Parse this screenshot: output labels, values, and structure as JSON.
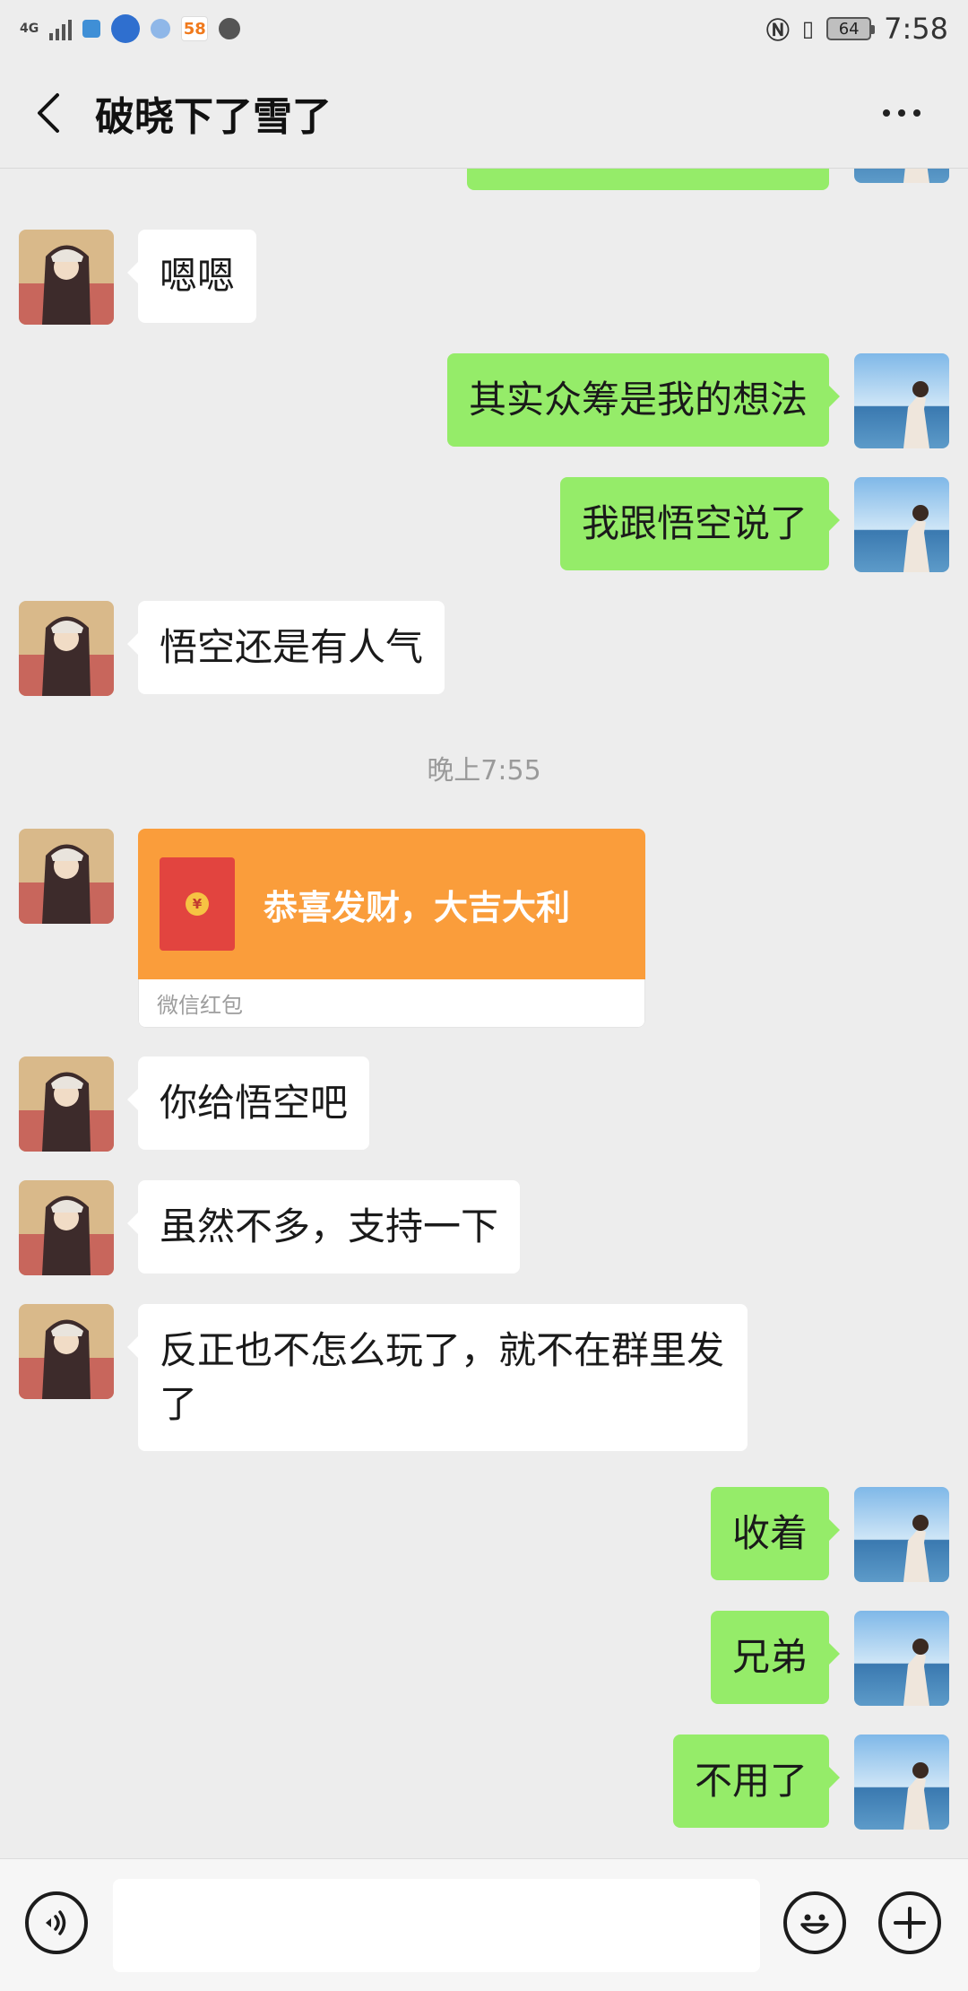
{
  "status_bar": {
    "network": "4G",
    "battery": "64",
    "time": "7:58",
    "app_icon_58": "58"
  },
  "header": {
    "title": "破晓下了雪了",
    "back_icon": "chevron-left-icon",
    "more_icon": "more-dots-icon"
  },
  "messages": [
    {
      "type": "text",
      "side": "in",
      "text": "嗯嗯"
    },
    {
      "type": "text",
      "side": "out",
      "text": "其实众筹是我的想法"
    },
    {
      "type": "text",
      "side": "out",
      "text": "我跟悟空说了"
    },
    {
      "type": "text",
      "side": "in",
      "text": "悟空还是有人气"
    },
    {
      "type": "time",
      "text": "晚上7:55"
    },
    {
      "type": "red_packet",
      "side": "in",
      "title": "恭喜发财，大吉大利",
      "footer": "微信红包"
    },
    {
      "type": "text",
      "side": "in",
      "text": "你给悟空吧"
    },
    {
      "type": "text",
      "side": "in",
      "text": "虽然不多，支持一下"
    },
    {
      "type": "text",
      "side": "in",
      "text": "反正也不怎么玩了，就不在群里发了"
    },
    {
      "type": "text",
      "side": "out",
      "text": "收着"
    },
    {
      "type": "text",
      "side": "out",
      "text": "兄弟"
    },
    {
      "type": "text",
      "side": "out",
      "text": "不用了"
    }
  ],
  "input_bar": {
    "voice_icon": "voice-icon",
    "emoji_icon": "emoji-icon",
    "plus_icon": "plus-icon",
    "message_value": ""
  },
  "colors": {
    "background": "#ededed",
    "outgoing_bubble": "#95ec69",
    "incoming_bubble": "#ffffff",
    "red_packet": "#fa9d3b"
  }
}
